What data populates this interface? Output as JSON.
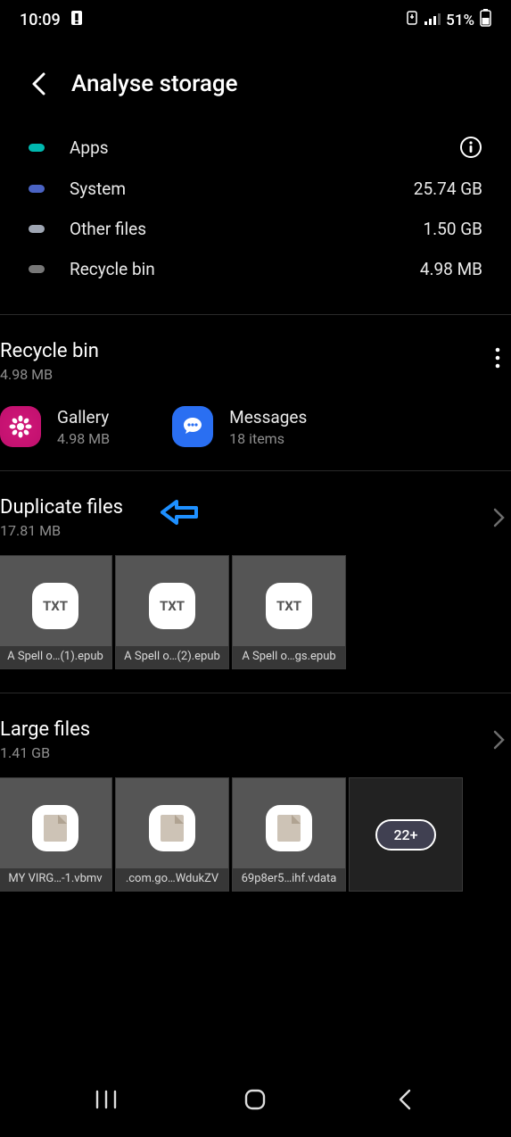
{
  "status": {
    "time": "10:09",
    "battery": "51%"
  },
  "header": {
    "title": "Analyse storage"
  },
  "storage": [
    {
      "label": "Apps",
      "value": "",
      "color": "#00b9b0",
      "info": true
    },
    {
      "label": "System",
      "value": "25.74 GB",
      "color": "#4a63c4"
    },
    {
      "label": "Other files",
      "value": "1.50 GB",
      "color": "#9fa6b3"
    },
    {
      "label": "Recycle bin",
      "value": "4.98 MB",
      "color": "#777777"
    }
  ],
  "recycle": {
    "title": "Recycle bin",
    "size": "4.98 MB",
    "items": [
      {
        "name": "Gallery",
        "sub": "4.98 MB"
      },
      {
        "name": "Messages",
        "sub": "18 items"
      }
    ]
  },
  "duplicates": {
    "title": "Duplicate files",
    "size": "17.81 MB",
    "files": [
      {
        "name": "A Spell o…(1).epub"
      },
      {
        "name": "A Spell o…(2).epub"
      },
      {
        "name": "A Spell o…gs.epub"
      }
    ]
  },
  "large": {
    "title": "Large files",
    "size": "1.41 GB",
    "files": [
      {
        "name": "MY VIRG…-1.vbmv"
      },
      {
        "name": ".com.go…WdukZV"
      },
      {
        "name": "69p8er5…ihf.vdata"
      }
    ],
    "more": "22+"
  }
}
